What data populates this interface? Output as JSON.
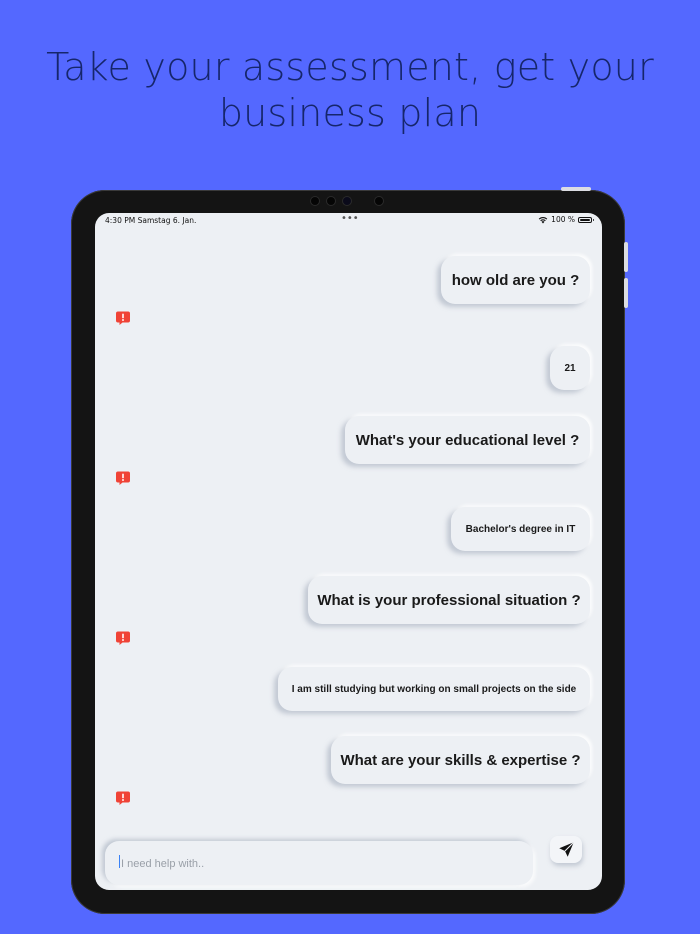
{
  "headline": {
    "line1": "Take your assessment, get your",
    "line2": "business plan"
  },
  "status_bar": {
    "time_date": "4:30 PM   Samstag 6. Jan.",
    "dots": "•••",
    "battery": "100 %"
  },
  "chat": {
    "messages": [
      {
        "type": "question",
        "text": "how old are you ?"
      },
      {
        "type": "answer",
        "text": "21"
      },
      {
        "type": "question",
        "text": "What's your educational level ?"
      },
      {
        "type": "answer",
        "text": "Bachelor's degree in IT"
      },
      {
        "type": "question",
        "text": "What is your professional situation ?"
      },
      {
        "type": "answer",
        "text": "I am still studying but working on small projects on the side"
      },
      {
        "type": "question",
        "text": "What are your skills & expertise ?"
      }
    ],
    "alert_icon": "speech-bubble-exclamation-icon",
    "alert_color": "#f04336"
  },
  "composer": {
    "placeholder": "I need help with..",
    "value": "",
    "send_icon": "paper-plane-icon"
  },
  "colors": {
    "background": "#5468ff",
    "headline": "#16266b",
    "screen": "#edf0f4",
    "alert": "#f04336"
  }
}
